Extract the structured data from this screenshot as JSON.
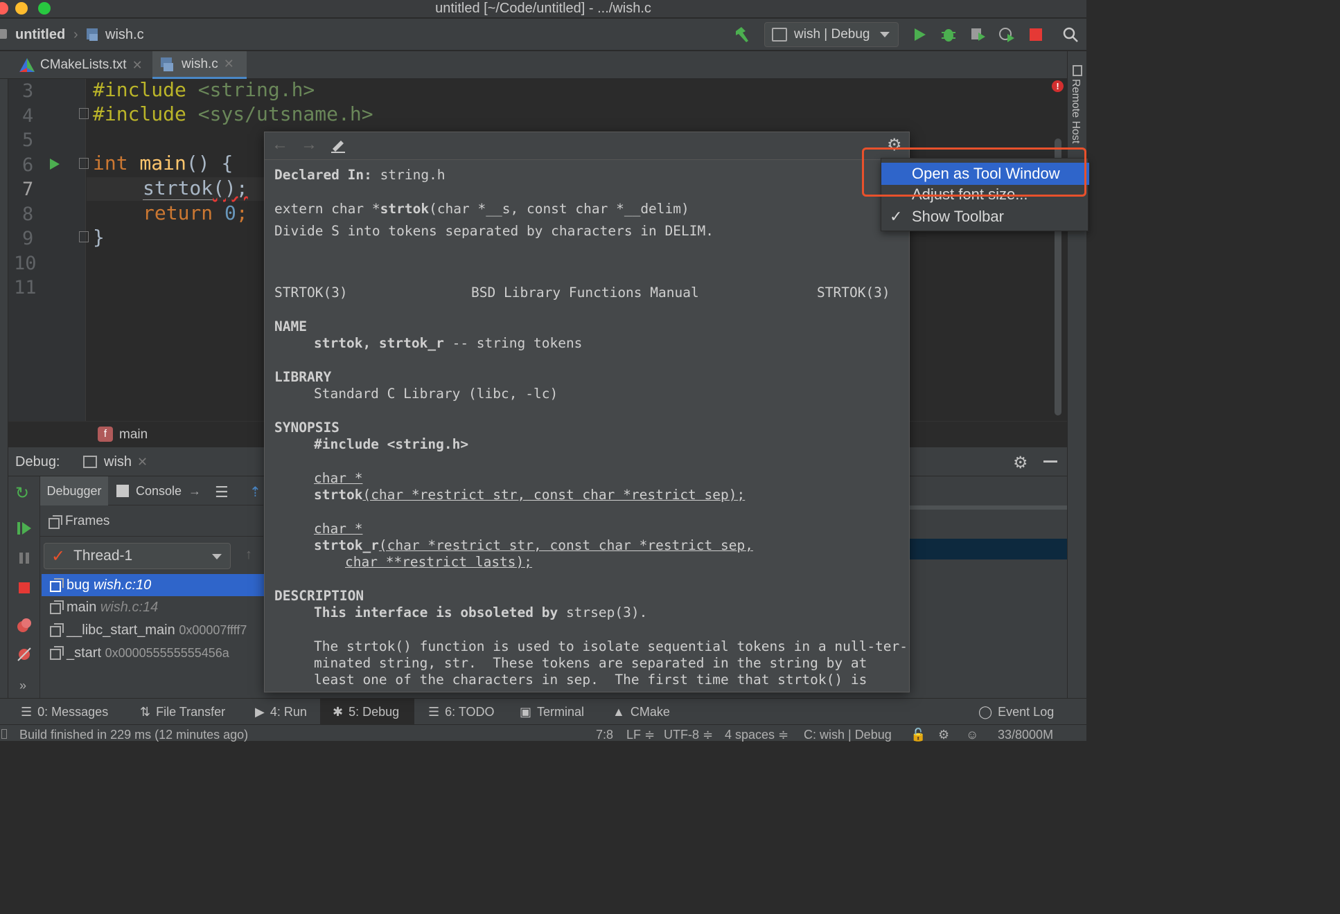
{
  "window": {
    "title": "untitled [~/Code/untitled] - .../wish.c"
  },
  "nav": {
    "project": "untitled",
    "file": "wish.c",
    "run_config": "wish | Debug"
  },
  "editor_tabs": [
    {
      "label": "CMakeLists.txt"
    },
    {
      "label": "wish.c"
    }
  ],
  "editor": {
    "line_numbers": [
      "3",
      "4",
      "5",
      "6",
      "7",
      "8",
      "9",
      "10",
      "11"
    ],
    "lines": {
      "l3_kw": "#include",
      "l3_str": " <string.h>",
      "l4_kw": "#include",
      "l4_str": " <sys/utsname.h>",
      "l6_int": "int",
      "l6_main": " main",
      "l6_rest": "() {",
      "l7_fn": "strtok",
      "l7_rest": "();",
      "l8_ret": "return",
      "l8_num": " 0",
      "l8_semi": ";",
      "l9": "}"
    },
    "breadcrumb": "main",
    "breadcrumb_badge": "f"
  },
  "debug": {
    "label": "Debug:",
    "session": "wish",
    "tabs": {
      "debugger": "Debugger",
      "console": "Console"
    },
    "frames_label": "Frames",
    "thread": "Thread-1",
    "frames": [
      {
        "name": "bug",
        "location": "wish.c:10"
      },
      {
        "name": "main",
        "location": "wish.c:14"
      },
      {
        "name": "__libc_start_main",
        "location": "0x00007ffff7"
      },
      {
        "name": "_start",
        "location": "0x000055555555456a"
      }
    ]
  },
  "doc_popup": {
    "declared_label": "Declared In:",
    "declared_value": " string.h",
    "signature_pre": "extern char *",
    "signature_name": "strtok",
    "signature_post": "(char *__s, const char *__delim)",
    "summary": "Divide S into tokens separated by characters in DELIM.",
    "man_left": "STRTOK(3)",
    "man_center": "BSD Library Functions Manual",
    "man_right": "STRTOK(3)",
    "name_heading": "NAME",
    "name_body_bold": "strtok, strtok_r",
    "name_body_rest": " -- string tokens",
    "library_heading": "LIBRARY",
    "library_body": "Standard C Library (libc, -lc)",
    "synopsis_heading": "SYNOPSIS",
    "synopsis_include": "#include <string.h>",
    "syn1_type": "char *",
    "syn1_name": "strtok",
    "syn1_args": "(char *restrict str, const char *restrict sep);",
    "syn2_type": "char *",
    "syn2_name": "strtok_r",
    "syn2_args": "(char *restrict str, const char *restrict sep,",
    "syn2_args2": "char **restrict lasts);",
    "description_heading": "DESCRIPTION",
    "desc_bold": "This interface is obsoleted by",
    "desc_bold_rest": " strsep(3).",
    "desc_p1": "The strtok() function is used to isolate sequential tokens in a null-ter-",
    "desc_p2": "minated string, str.  These tokens are separated in the string by at",
    "desc_p3": "least one of the characters in sep.  The first time that strtok() is"
  },
  "context_menu": {
    "items": [
      "Open as Tool Window",
      "Adjust font size...",
      "Show Toolbar"
    ],
    "checked": "✓"
  },
  "right_strip": {
    "label": "Remote Host"
  },
  "bottom_tools": {
    "messages": "0: Messages",
    "file_transfer": "File Transfer",
    "run": "4: Run",
    "debug": "5: Debug",
    "todo": "6: TODO",
    "terminal": "Terminal",
    "cmake": "CMake",
    "event_log": "Event Log"
  },
  "status": {
    "message": "Build finished in 229 ms (12 minutes ago)",
    "position": "7:8",
    "line_sep": "LF ≑",
    "encoding": "UTF-8 ≑",
    "indent": "4 spaces ≑",
    "context": "C: wish | Debug",
    "memory": "33/8000M"
  },
  "colors": {
    "accent_selection": "#2f65ca",
    "highlight_box": "#e8512c",
    "run_green": "#4caf50",
    "stop_red": "#e53935"
  }
}
